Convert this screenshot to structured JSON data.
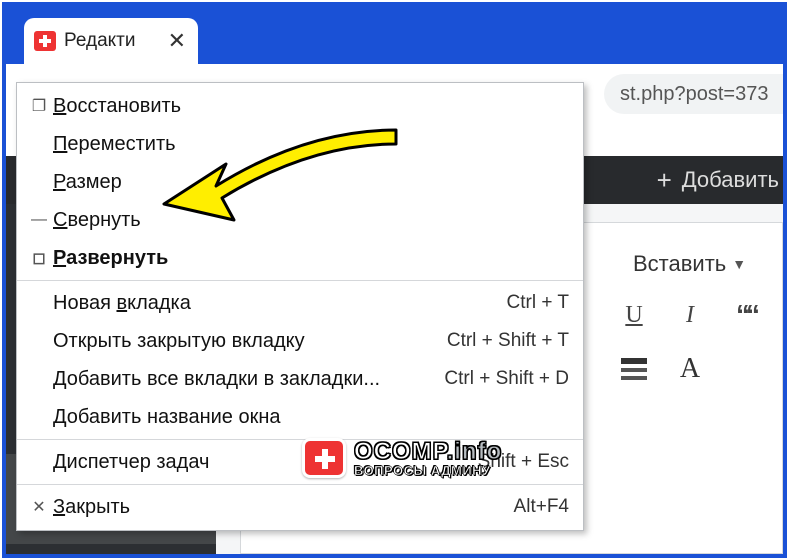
{
  "tab": {
    "title": "Редакти",
    "close_glyph": "✕"
  },
  "url_fragment": "st.php?post=373",
  "wp": {
    "add_label": "Добавить",
    "insert_label": "Вставить"
  },
  "menu": {
    "restore": "осстановить",
    "move": "ереместить",
    "size": "азмер",
    "minimize": "вернуть",
    "maximize": "азвернуть",
    "new_tab": {
      "label_pre": "Новая ",
      "label_u": "в",
      "label_post": "кладка",
      "shortcut": "Ctrl + T"
    },
    "reopen_tab": {
      "label": "Открыть закрытую вкладку",
      "shortcut": "Ctrl + Shift + T"
    },
    "bookmark_all": {
      "label": "Добавить все вкладки в закладки...",
      "shortcut": "Ctrl + Shift + D"
    },
    "name_window": {
      "label": "Добавить название окна"
    },
    "task_mgr": {
      "label": "Диспетчер задач",
      "shortcut": "Shift + Esc"
    },
    "close": {
      "label_u": "З",
      "label_post": "акрыть",
      "shortcut": "Alt+F4"
    }
  },
  "watermark": {
    "brand": "OCOMP",
    "tld": ".info",
    "subtitle": "ВОПРОСЫ АДМИНУ"
  }
}
